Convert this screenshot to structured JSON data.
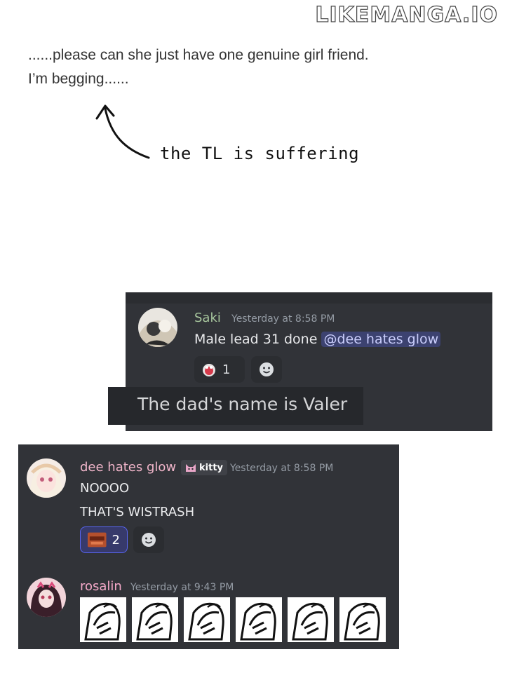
{
  "watermark": "LIKEMANGA.IO",
  "translator_note": {
    "line1": "......please can she just have one genuine girl friend.",
    "line2": "I’m begging......",
    "handwritten": "the TL is suffering"
  },
  "chat1": {
    "author": "Saki",
    "author_color": "#a8c79e",
    "timestamp": "Yesterday at 8:58 PM",
    "message_prefix": "Male lead 31 done ",
    "mention": "@dee hates glow",
    "reaction_count": "1",
    "reaction_icon": "red-monster-emoji",
    "add_reaction_icon": "smiley-icon"
  },
  "overlay_text": "The dad's name is Valer",
  "chat2": {
    "author": "dee hates glow",
    "author_color": "#f2b6cb",
    "tag_label": "kitty",
    "timestamp": "Yesterday at 8:58 PM",
    "messages": [
      "NOOOO",
      "THAT'S WISTRASH"
    ],
    "reaction_count": "2",
    "reaction_icon": "angry-face-emoji"
  },
  "chat3": {
    "author": "rosalin",
    "author_color": "#f5a9c9",
    "timestamp": "Yesterday at 9:43 PM",
    "sticker_icon": "facepalm-sticker"
  }
}
